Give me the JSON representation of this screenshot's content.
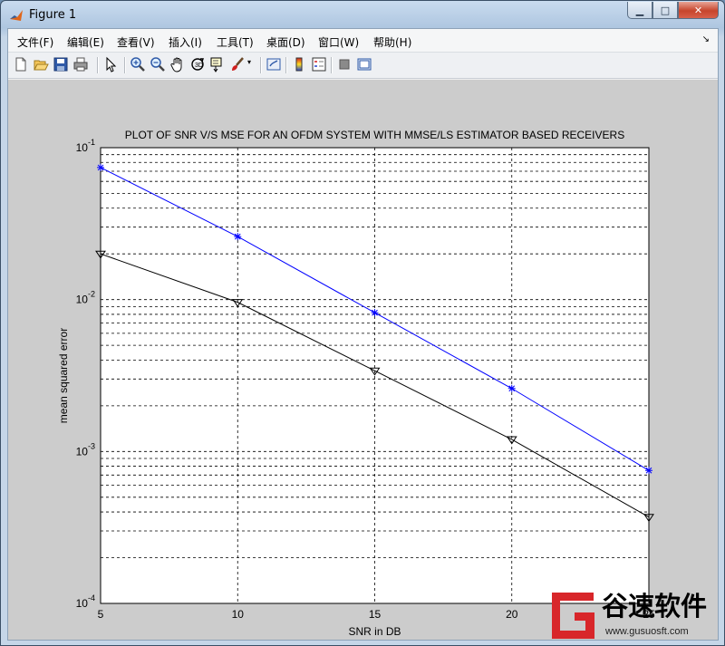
{
  "window": {
    "title": "Figure 1"
  },
  "menu": [
    "文件(F)",
    "编辑(E)",
    "查看(V)",
    "插入(I)",
    "工具(T)",
    "桌面(D)",
    "窗口(W)",
    "帮助(H)"
  ],
  "menu_overflow": "↘",
  "toolbar_icons": [
    "new-figure-icon",
    "open-file-icon",
    "save-icon",
    "print-icon",
    "pointer-icon",
    "zoom-in-icon",
    "zoom-out-icon",
    "pan-icon",
    "rotate-3d-icon",
    "data-cursor-icon",
    "brush-icon",
    "brush-dropdown-icon",
    "link-icon",
    "colorbar-icon",
    "legend-icon",
    "hide-plot-tools-icon",
    "show-plot-tools-icon"
  ],
  "chart_data": {
    "type": "line",
    "title": "PLOT OF SNR V/S MSE FOR AN OFDM SYSTEM WITH MMSE/LS ESTIMATOR BASED RECEIVERS",
    "xlabel": "SNR in DB",
    "ylabel": "mean squared error",
    "x": [
      5,
      10,
      15,
      20,
      25
    ],
    "xlim": [
      5,
      25
    ],
    "ylim": [
      0.0001,
      0.1
    ],
    "yscale": "log",
    "xticks": [
      "5",
      "10",
      "15",
      "20",
      "25"
    ],
    "yticks": [
      {
        "base": "10",
        "exp": "-1",
        "value": 0.1
      },
      {
        "base": "10",
        "exp": "-2",
        "value": 0.01
      },
      {
        "base": "10",
        "exp": "-3",
        "value": 0.001
      },
      {
        "base": "10",
        "exp": "-4",
        "value": 0.0001
      }
    ],
    "grid": true,
    "series": [
      {
        "marker": "*",
        "color": "#0000ff",
        "values": [
          0.074,
          0.026,
          0.0082,
          0.0026,
          0.00075
        ]
      },
      {
        "marker": "triangle-down",
        "color": "#000000",
        "values": [
          0.02,
          0.0096,
          0.0034,
          0.0012,
          0.00037
        ]
      }
    ]
  },
  "watermark": {
    "brand": "谷速软件",
    "url": "www.gusuosft.com"
  }
}
